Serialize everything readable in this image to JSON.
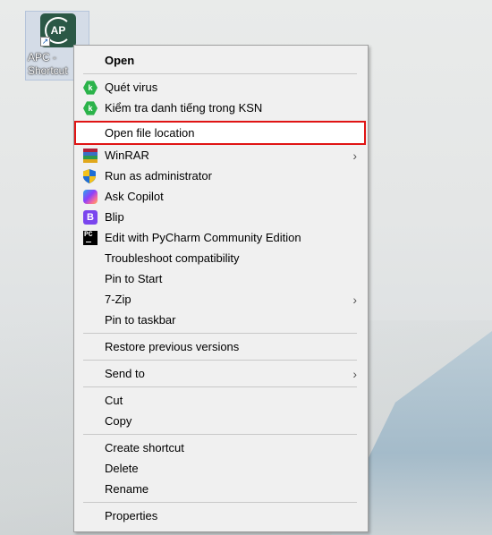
{
  "desktop": {
    "shortcut": {
      "label": "APC -\nShortcut",
      "icon": "apc-app-icon",
      "logo_text": "AP"
    }
  },
  "menu": {
    "items": [
      {
        "label": "Open",
        "bold": true
      },
      {
        "label": "Quét virus",
        "icon": "kaspersky-icon"
      },
      {
        "label": "Kiểm tra danh tiếng trong KSN",
        "icon": "kaspersky-icon"
      },
      {
        "label": "Open file location",
        "highlighted": true
      },
      {
        "label": "WinRAR",
        "icon": "winrar-icon",
        "submenu": true
      },
      {
        "label": "Run as administrator",
        "icon": "uac-shield-icon"
      },
      {
        "label": "Ask Copilot",
        "icon": "copilot-icon"
      },
      {
        "label": "Blip",
        "icon": "blip-icon"
      },
      {
        "label": "Edit with PyCharm Community Edition",
        "icon": "pycharm-icon"
      },
      {
        "label": "Troubleshoot compatibility"
      },
      {
        "label": "Pin to Start"
      },
      {
        "label": "7-Zip",
        "submenu": true
      },
      {
        "label": "Pin to taskbar"
      },
      {
        "label": "Restore previous versions"
      },
      {
        "label": "Send to",
        "submenu": true
      },
      {
        "label": "Cut"
      },
      {
        "label": "Copy"
      },
      {
        "label": "Create shortcut"
      },
      {
        "label": "Delete"
      },
      {
        "label": "Rename"
      },
      {
        "label": "Properties"
      }
    ],
    "glyphs": {
      "kaspersky": "k",
      "blip": "B",
      "pycharm": "PC",
      "submenu_arrow": "›"
    }
  },
  "colors": {
    "highlight_border": "#e01414",
    "menu_background": "#f0f0f0",
    "kaspersky_green": "#2bb34a",
    "blip_purple": "#7a45ee"
  }
}
